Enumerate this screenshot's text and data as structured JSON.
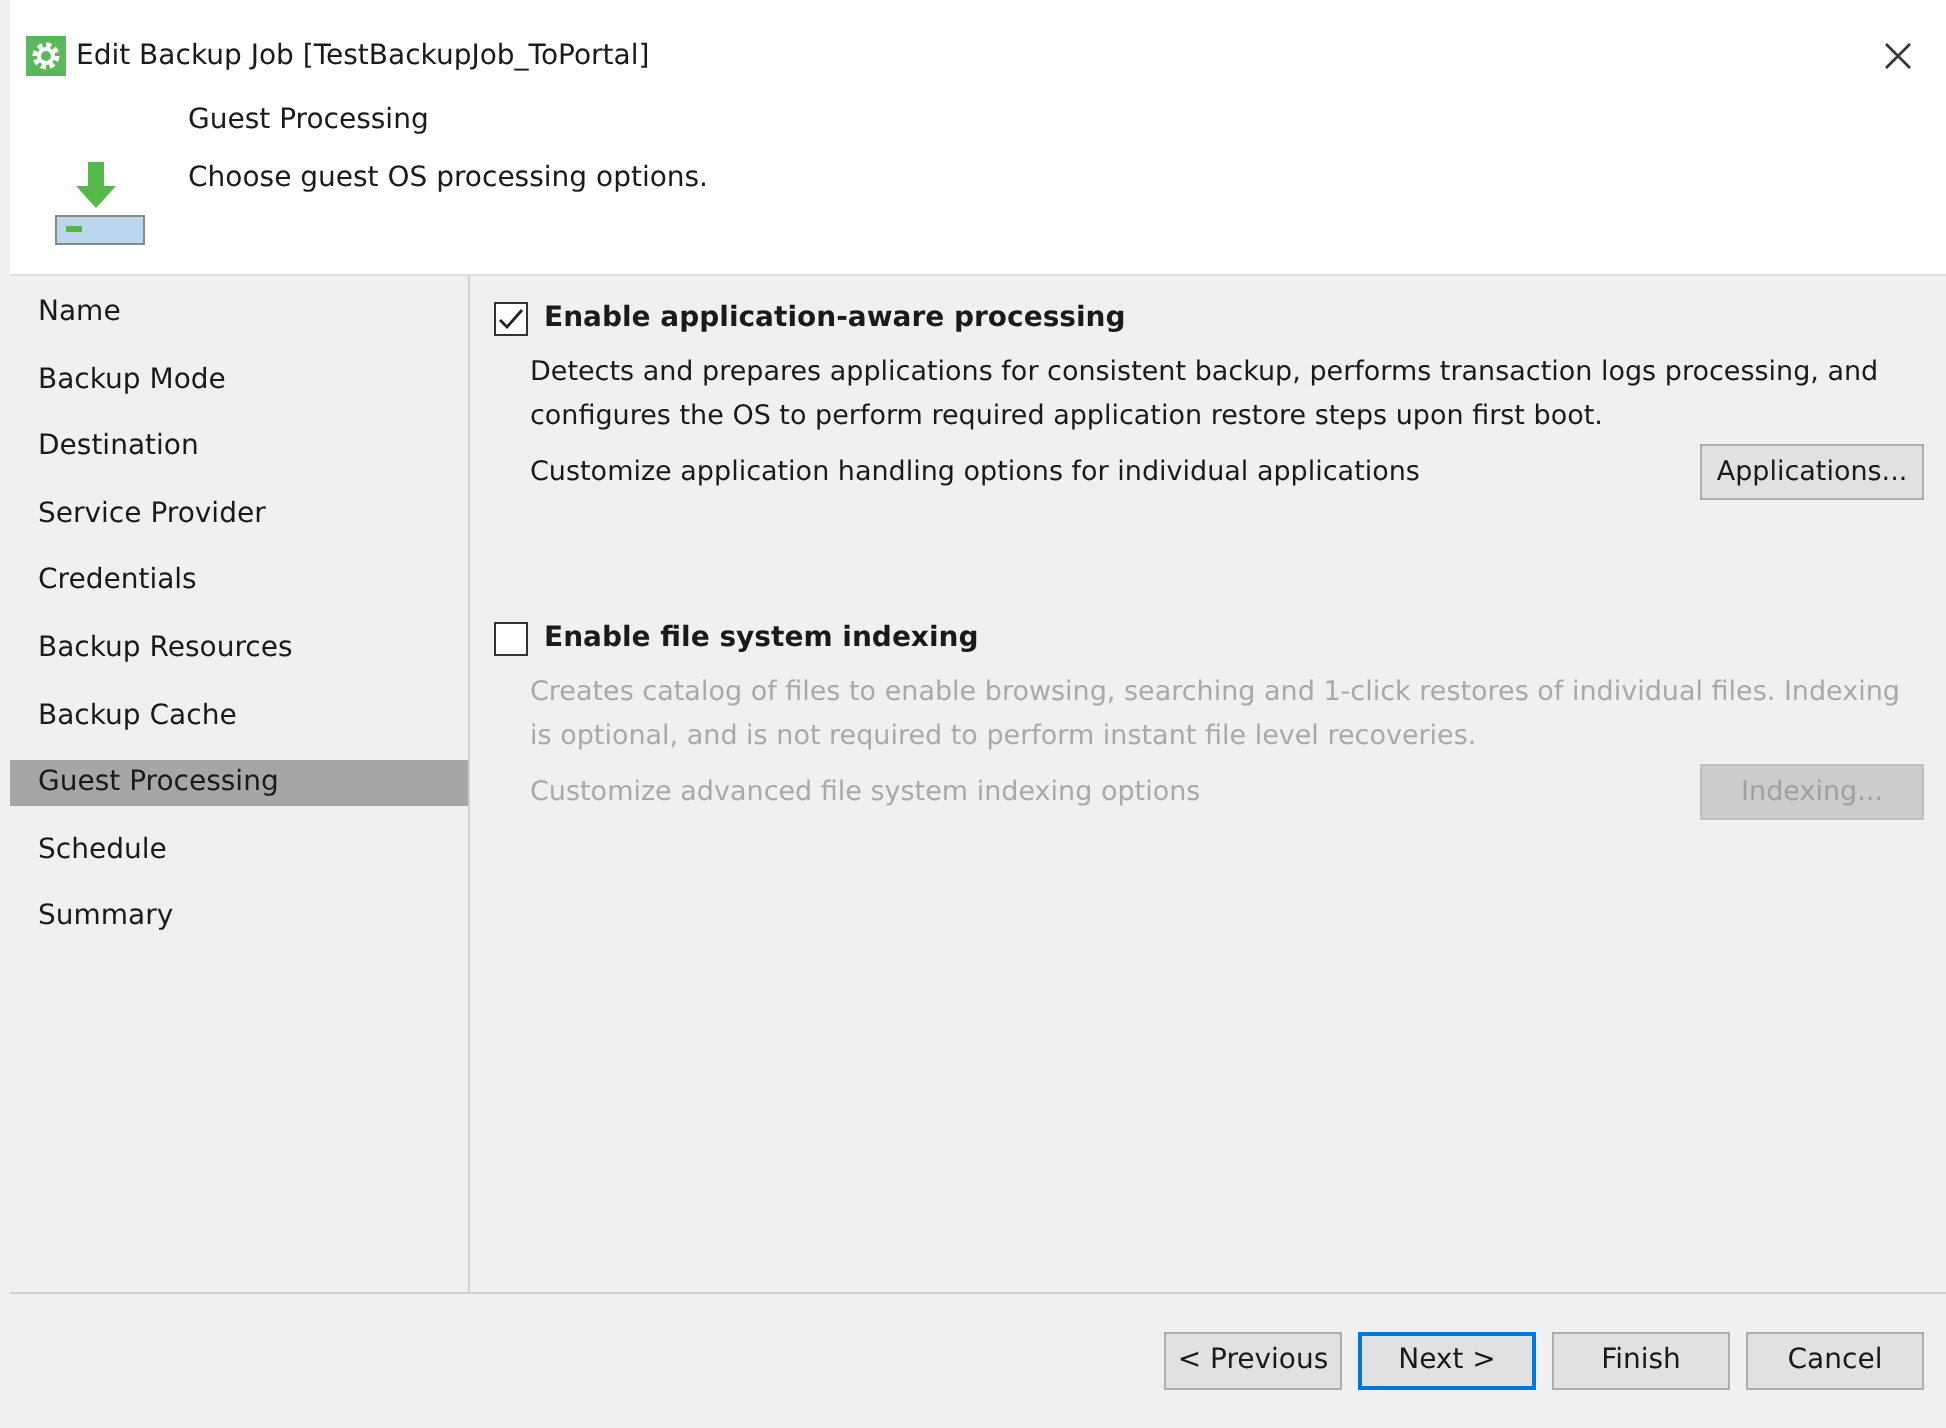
{
  "window": {
    "title": "Edit Backup Job [TestBackupJob_ToPortal]"
  },
  "header": {
    "title": "Guest Processing",
    "subtitle": "Choose guest OS processing options."
  },
  "steps": [
    {
      "label": "Name",
      "selected": false
    },
    {
      "label": "Backup Mode",
      "selected": false
    },
    {
      "label": "Destination",
      "selected": false
    },
    {
      "label": "Service Provider",
      "selected": false
    },
    {
      "label": "Credentials",
      "selected": false
    },
    {
      "label": "Backup Resources",
      "selected": false
    },
    {
      "label": "Backup Cache",
      "selected": false
    },
    {
      "label": "Guest Processing",
      "selected": true
    },
    {
      "label": "Schedule",
      "selected": false
    },
    {
      "label": "Summary",
      "selected": false
    }
  ],
  "sections": [
    {
      "label": "Enable application-aware processing",
      "checked": true,
      "disabled": false,
      "description": "Detects and prepares applications for consistent backup, performs transaction logs processing, and configures the OS to perform required application restore steps upon first boot.",
      "customize": "Customize application handling options for individual applications",
      "button": "Applications..."
    },
    {
      "label": "Enable file system indexing",
      "checked": false,
      "disabled": true,
      "description": "Creates catalog of files to enable browsing, searching and 1-click restores of individual files. Indexing is optional, and is not required to perform instant file level recoveries.",
      "customize": "Customize advanced file system indexing options",
      "button": "Indexing..."
    }
  ],
  "buttons": [
    {
      "label": "< Previous",
      "focused": false
    },
    {
      "label": "Next >",
      "focused": true
    },
    {
      "label": "Finish",
      "focused": false
    },
    {
      "label": "Cancel",
      "focused": false
    }
  ]
}
